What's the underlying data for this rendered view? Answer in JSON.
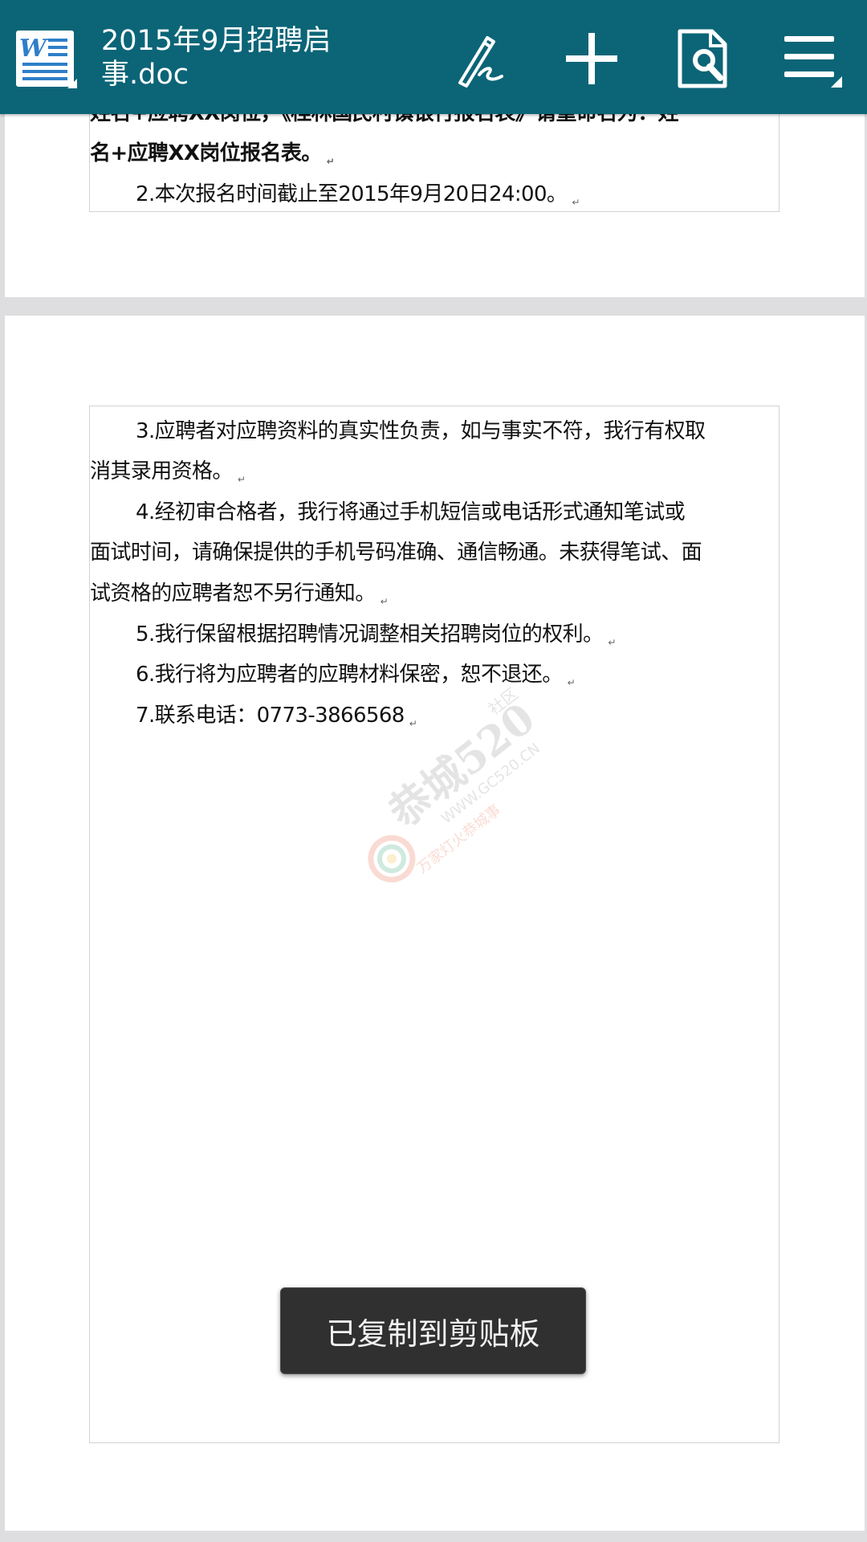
{
  "appbar": {
    "title": "2015年9月招聘启事.doc",
    "app_icon": "word-document-icon",
    "actions": [
      {
        "name": "edit-pen-icon"
      },
      {
        "name": "add-icon"
      },
      {
        "name": "document-tools-icon"
      },
      {
        "name": "menu-icon"
      }
    ],
    "background": "#0b6577"
  },
  "document": {
    "page1": {
      "cut_line": "姓名+应聘XX岗位，《桂林国民村镇银行报名表》请重命名为：姓",
      "line_bold_end": "名+应聘XX岗位报名表。",
      "item2": "2.本次报名时间截止至2015年9月20日24:00。"
    },
    "page2": {
      "item3_l1": "3.应聘者对应聘资料的真实性负责，如与事实不符，我行有权取",
      "item3_l2": "消其录用资格。",
      "item4_l1": "4.经初审合格者，我行将通过手机短信或电话形式通知笔试或",
      "item4_l2": "面试时间，请确保提供的手机号码准确、通信畅通。未获得笔试、面",
      "item4_l3": "试资格的应聘者恕不另行通知。",
      "item5": "5.我行保留根据招聘情况调整相关招聘岗位的权利。",
      "item6": "6.我行将为应聘者的应聘材料保密，恕不退还。",
      "item7": "7.联系电话：0773-3866568"
    }
  },
  "watermark": {
    "brand": "恭城520",
    "side": "社区",
    "url": "WWW.GC520.CN",
    "slogan": "万家灯火恭城事"
  },
  "toast": {
    "message": "已复制到剪贴板"
  }
}
